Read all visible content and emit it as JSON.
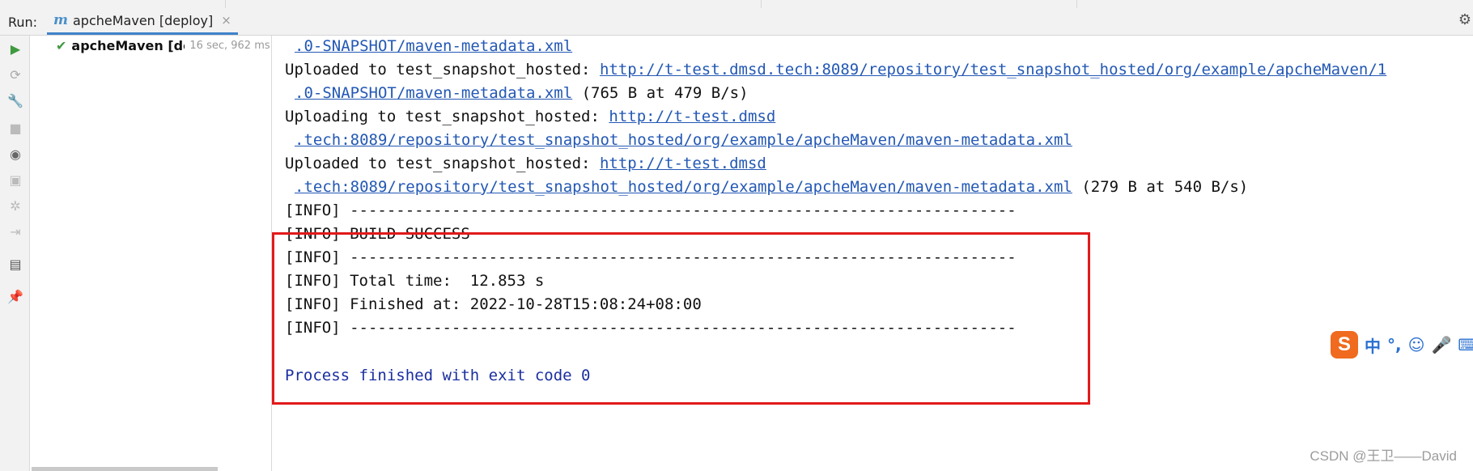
{
  "window": {
    "run_label": "Run:",
    "tab_icon": "m",
    "tab_title": "apcheMaven [deploy]",
    "tab_close": "×",
    "settings_icon": "gear-icon"
  },
  "toolbar": {
    "icons": [
      "run-icon",
      "rerun-failed-icon",
      "wrench-icon",
      "stop-icon",
      "eye-icon",
      "camera-icon",
      "settings-icon",
      "import-icon",
      "layout-icon",
      "pin-icon"
    ]
  },
  "tree": {
    "item_title": "apcheMaven [deploy]",
    "item_time": "16 sec, 962 ms",
    "status": "success"
  },
  "console": {
    "l1_link": ".0-SNAPSHOT/maven-metadata.xml",
    "l2_text": "Uploaded to test_snapshot_hosted: ",
    "l2_link": "http://t-test.dmsd.tech:8089/repository/test_snapshot_hosted/org/example/apcheMaven/1",
    "l3_link": ".0-SNAPSHOT/maven-metadata.xml",
    "l3_text": " (765 B at 479 B/s)",
    "l4_text": "Uploading to test_snapshot_hosted: ",
    "l4_link": "http://t-test.dmsd",
    "l5_link": ".tech:8089/repository/test_snapshot_hosted/org/example/apcheMaven/maven-metadata.xml",
    "l6_text": "Uploaded to test_snapshot_hosted: ",
    "l6_link": "http://t-test.dmsd",
    "l7_link": ".tech:8089/repository/test_snapshot_hosted/org/example/apcheMaven/maven-metadata.xml",
    "l7_text": " (279 B at 540 B/s)",
    "info1": "[INFO] ------------------------------------------------------------------------",
    "info2": "[INFO] BUILD SUCCESS",
    "info3": "[INFO] ------------------------------------------------------------------------",
    "info4": "[INFO] Total time:  12.853 s",
    "info5": "[INFO] Finished at: 2022-10-28T15:08:24+08:00",
    "info6": "[INFO] ------------------------------------------------------------------------",
    "process": "Process finished with exit code 0"
  },
  "ime": {
    "logo": "S",
    "items": [
      "中",
      "°,",
      "☺",
      "🎤",
      "⌨",
      "⋯"
    ]
  },
  "watermark": "CSDN @王卫——David"
}
